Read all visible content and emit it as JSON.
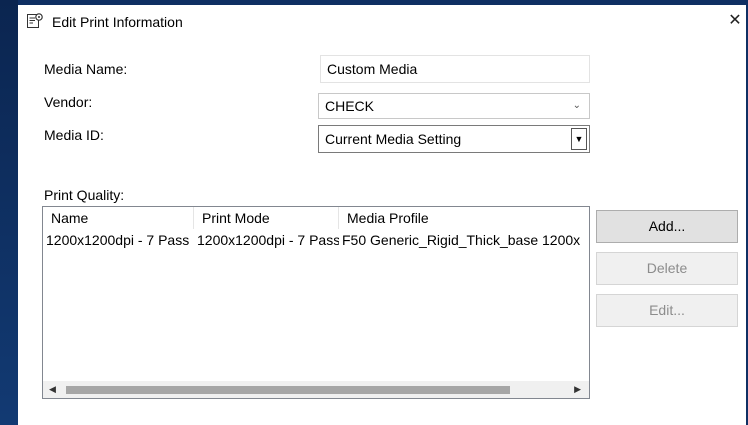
{
  "window": {
    "title": "Edit Print Information",
    "close_glyph": "✕",
    "icon": "edit-settings-icon"
  },
  "form": {
    "media_name_label": "Media Name:",
    "media_name_value": "Custom Media",
    "vendor_label": "Vendor:",
    "vendor_value": "CHECK",
    "media_id_label": "Media ID:",
    "media_id_value": "Current Media Setting"
  },
  "print_quality": {
    "label": "Print Quality:",
    "columns": [
      "Name",
      "Print Mode",
      "Media Profile"
    ],
    "rows": [
      [
        "1200x1200dpi - 7 Pass",
        "1200x1200dpi - 7 Pass",
        "F50 Generic_Rigid_Thick_base 1200x"
      ]
    ]
  },
  "buttons": {
    "add": "Add...",
    "delete": "Delete",
    "edit": "Edit..."
  }
}
